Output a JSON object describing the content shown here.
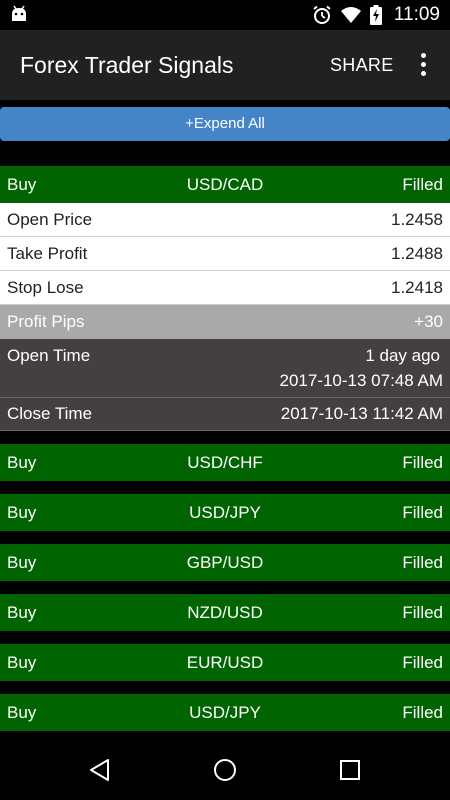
{
  "status_bar": {
    "time": "11:09",
    "icons": [
      "android-icon",
      "alarm-icon",
      "wifi-icon",
      "battery-charging-icon"
    ]
  },
  "app_bar": {
    "title": "Forex Trader Signals",
    "share_label": "SHARE",
    "overflow_icon": "more-vert-icon"
  },
  "expand_all_label": "+Expend All",
  "expanded_signal": {
    "action": "Buy",
    "pair": "USD/CAD",
    "status": "Filled",
    "open_price": {
      "label": "Open Price",
      "value": "1.2458"
    },
    "take_profit": {
      "label": "Take Profit",
      "value": "1.2488"
    },
    "stop_lose": {
      "label": "Stop Lose",
      "value": "1.2418"
    },
    "profit_pips": {
      "label": "Profit Pips",
      "value": "+30"
    },
    "open_time": {
      "label": "Open Time",
      "relative": "1 day ago",
      "value": "2017-10-13 07:48 AM"
    },
    "close_time": {
      "label": "Close Time",
      "value": "2017-10-13 11:42 AM"
    }
  },
  "signals": [
    {
      "action": "Buy",
      "pair": "USD/CHF",
      "status": "Filled"
    },
    {
      "action": "Buy",
      "pair": "USD/JPY",
      "status": "Filled"
    },
    {
      "action": "Buy",
      "pair": "GBP/USD",
      "status": "Filled"
    },
    {
      "action": "Buy",
      "pair": "NZD/USD",
      "status": "Filled"
    },
    {
      "action": "Buy",
      "pair": "EUR/USD",
      "status": "Filled"
    },
    {
      "action": "Buy",
      "pair": "USD/JPY",
      "status": "Filled"
    }
  ],
  "colors": {
    "signal_green": "#006500",
    "expand_blue": "#4485c7",
    "app_bar": "#212121",
    "profit_gray": "#a9a9a9",
    "time_dark": "#443f40"
  },
  "nav_bar": {
    "icons": [
      "back-icon",
      "home-icon",
      "recents-icon"
    ]
  }
}
